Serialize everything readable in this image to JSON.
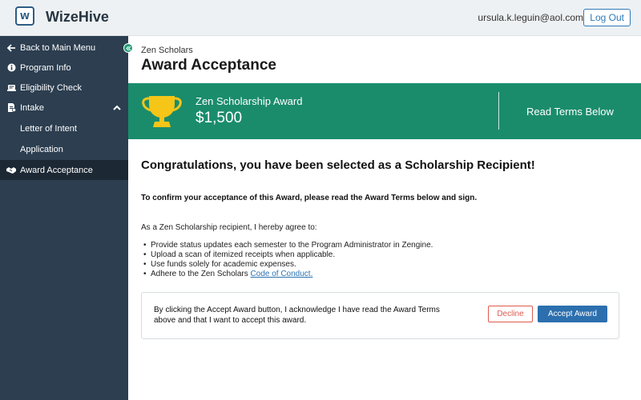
{
  "header": {
    "logo_letter": "W",
    "brand": "WizeHive",
    "user_email": "ursula.k.leguin@aol.com",
    "logout_label": "Log Out"
  },
  "sidebar": {
    "items": [
      {
        "label": "Back to Main Menu",
        "icon": "arrow-left-icon"
      },
      {
        "label": "Program Info",
        "icon": "info-icon"
      },
      {
        "label": "Eligibility Check",
        "icon": "checklist-icon"
      },
      {
        "label": "Intake",
        "icon": "intake-icon"
      },
      {
        "label": "Letter of Intent"
      },
      {
        "label": "Application"
      },
      {
        "label": "Award Acceptance",
        "icon": "handshake-icon"
      }
    ]
  },
  "main": {
    "program_name": "Zen Scholars",
    "page_title": "Award Acceptance",
    "banner": {
      "award_name": "Zen Scholarship Award",
      "award_amount": "$1,500",
      "right_text": "Read Terms Below"
    },
    "congrats": "Congratulations, you have been selected as a Scholarship Recipient!",
    "instruction": "To confirm your acceptance of this Award, please read the Award Terms below and sign.",
    "agree_intro": "As a Zen Scholarship recipient, I hereby agree to:",
    "terms": [
      "Provide status updates each semester to the Program Administrator in Zengine.",
      "Upload a scan of itemized receipts when applicable.",
      "Use funds solely for academic expenses.",
      "Adhere to the Zen Scholars "
    ],
    "code_of_conduct_link": "Code of Conduct.",
    "accept_card": {
      "text": "By clicking the Accept Award button, I acknowledge I have read the Award Terms above and that I want to accept this award.",
      "decline_label": "Decline",
      "accept_label": "Accept Award"
    }
  },
  "colors": {
    "banner": "#1a8c6c",
    "sidebar": "#2c3e50",
    "accent_blue": "#2c6fae",
    "decline_red": "#e05a4e",
    "trophy_gold": "#f5c518"
  }
}
